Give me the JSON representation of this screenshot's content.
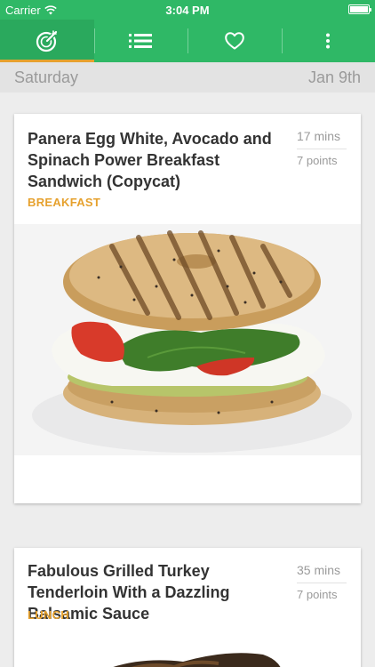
{
  "status_bar": {
    "carrier": "Carrier",
    "time": "3:04 PM"
  },
  "tabs": [
    {
      "icon": "food-plan-icon",
      "active": true
    },
    {
      "icon": "list-icon",
      "active": false
    },
    {
      "icon": "heart-icon",
      "active": false
    },
    {
      "icon": "more-icon",
      "active": false
    }
  ],
  "day_header": {
    "day": "Saturday",
    "date": "Jan 9th"
  },
  "recipes": [
    {
      "title": "Panera Egg White, Avocado and Spinach Power Breakfast Sandwich (Copycat)",
      "category": "BREAKFAST",
      "time": "17 mins",
      "points": "7 points"
    },
    {
      "title": "Fabulous Grilled Turkey Tenderloin With a Dazzling Balsamic Sauce",
      "category": "LUNCH",
      "time": "35 mins",
      "points": "7 points"
    }
  ],
  "colors": {
    "brand": "#2fb866",
    "accent": "#e6a12e"
  }
}
